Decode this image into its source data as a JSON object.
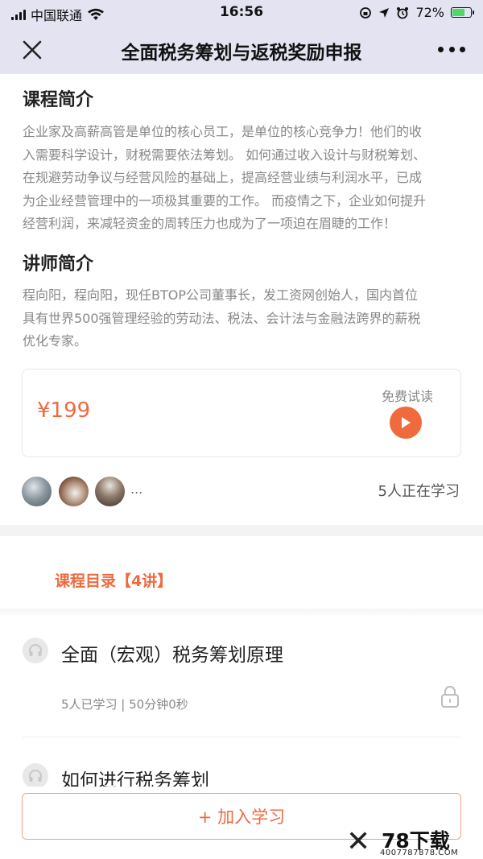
{
  "status_bar": {
    "carrier": "中国联通",
    "time": "16:56",
    "battery_percent": "72%",
    "battery_level": 0.72
  },
  "nav": {
    "title": "全面税务筹划与返税奖励申报",
    "close_icon": "close-icon",
    "more_icon": "more-icon"
  },
  "intro": {
    "title": "课程简介",
    "lines": [
      "企业家及高薪高管是单位的核心员工，是单位的核心竞争力！他们的收",
      "入需要科学设计，财税需要依法筹划。 如何通过收入设计与财税筹划、",
      "在规避劳动争议与经营风险的基础上，提高经营业绩与利润水平，已成",
      "为企业经营管理中的一项极其重要的工作。 而疫情之下，企业如何提升",
      "经营利润，来减轻资金的周转压力也成为了一项迫在眉睫的工作！"
    ]
  },
  "lecturer": {
    "title": "讲师简介",
    "lines": [
      "程向阳，程向阳，现任BTOP公司董事长，发工资网创始人，国内首位",
      "具有世界500强管理经验的劳动法、税法、会计法与金融法跨界的薪税",
      "优化专家。"
    ]
  },
  "price_card": {
    "price": "¥199",
    "trial_label": "免费试读",
    "play_icon": "play-icon"
  },
  "learners": {
    "ellipsis": "...",
    "count_text": "5人正在学习"
  },
  "catalog": {
    "title": "课程目录【4讲】",
    "lessons": [
      {
        "title": "全面（宏观）税务筹划原理",
        "meta": "5人已学习 | 50分钟0秒",
        "icon": "headphones-icon",
        "locked": true
      },
      {
        "title": "如何进行税务筹划",
        "icon": "headphones-icon"
      }
    ]
  },
  "bottom": {
    "join_label": "+ 加入学习"
  },
  "watermark": {
    "brand": "78下载",
    "sub": "4007787878.COM"
  },
  "colors": {
    "accent": "#ee6a3f",
    "nav_bg": "#e3e3f1",
    "text_gray": "#888888"
  }
}
